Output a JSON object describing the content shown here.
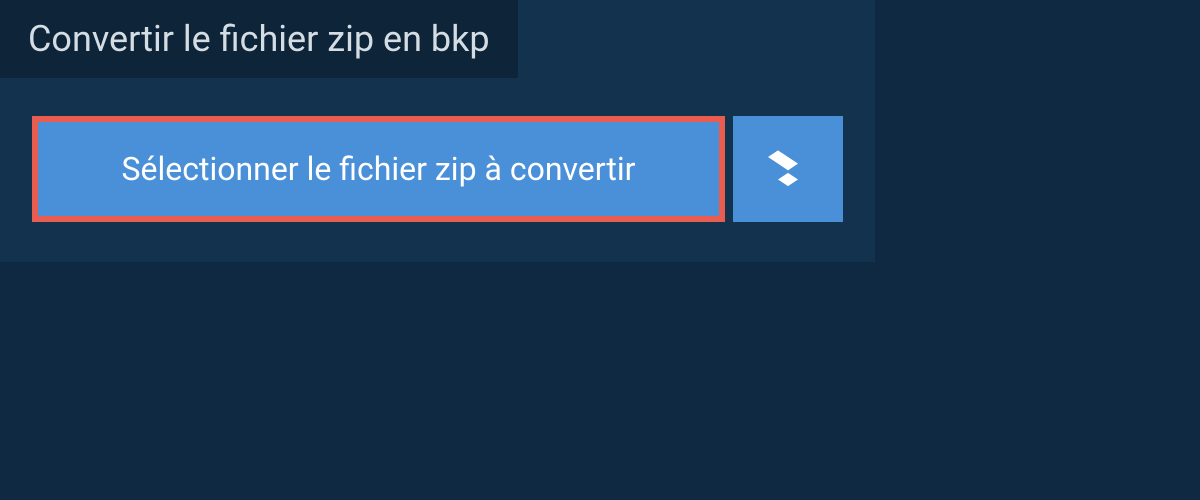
{
  "header": {
    "title": "Convertir le fichier zip en bkp"
  },
  "actions": {
    "select_file_label": "Sélectionner le fichier zip à convertir"
  },
  "colors": {
    "page_bg": "#0f2942",
    "panel_bg": "#12324e",
    "tab_bg": "#0d2439",
    "button_bg": "#4a90d9",
    "highlight_border": "#e85d4f"
  }
}
